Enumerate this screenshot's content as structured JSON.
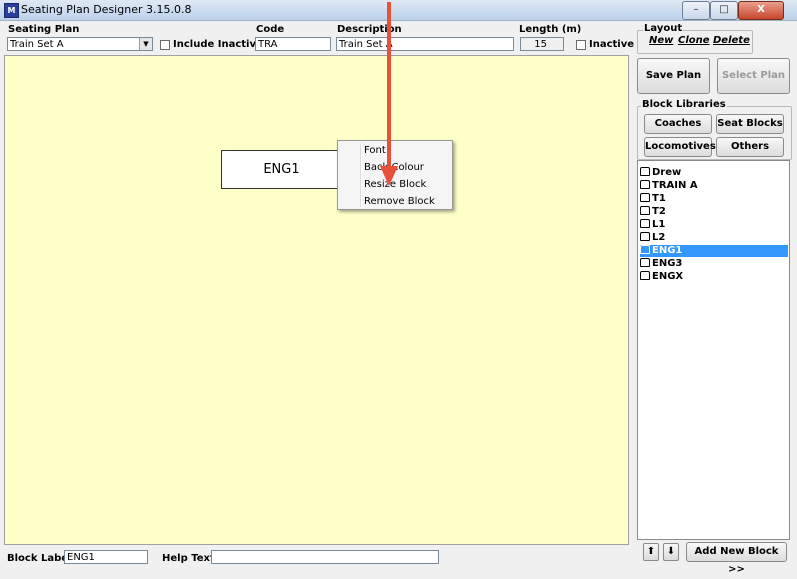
{
  "window": {
    "title": "Seating Plan Designer  3.15.0.8",
    "app_icon_text": "M",
    "minimize": "–",
    "maximize": "□",
    "close": "X"
  },
  "header": {
    "seating_plan_label": "Seating Plan",
    "seating_plan_value": "Train Set A",
    "include_inactive_label": "Include Inactive",
    "code_label": "Code",
    "code_value": "TRA",
    "description_label": "Description",
    "description_value": "Train Set A",
    "length_label": "Length (m)",
    "length_value": "15",
    "inactive_label": "Inactive"
  },
  "layout_group": {
    "title": "Layout",
    "new": "New",
    "clone": "Clone",
    "delete": "Delete"
  },
  "actions": {
    "save_plan": "Save Plan",
    "select_plan": "Select Plan"
  },
  "block_libraries": {
    "title": "Block Libraries",
    "coaches": "Coaches",
    "seat_blocks": "Seat Blocks",
    "locomotives": "Locomotives",
    "others": "Others"
  },
  "tree": {
    "items": [
      "Drew",
      "TRAIN A",
      "T1",
      "T2",
      "L1",
      "L2",
      "ENG1",
      "ENG3",
      "ENGX"
    ],
    "selected": "ENG1"
  },
  "canvas": {
    "block_label": "ENG1"
  },
  "context_menu": {
    "items": [
      "Font",
      "Back Colour",
      "Resize Block",
      "Remove Block"
    ]
  },
  "bottom": {
    "up_arrow": "⬆",
    "down_arrow": "⬇",
    "add_new_block": "Add New Block >>",
    "block_label_label": "Block Label",
    "block_label_value": "ENG1",
    "help_text_label": "Help Text",
    "help_text_value": ""
  },
  "colors": {
    "canvas_bg": "#ffffc8",
    "selection": "#3399ff",
    "arrow": "#e8503a"
  }
}
